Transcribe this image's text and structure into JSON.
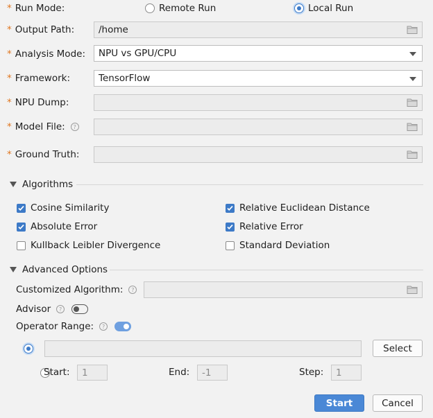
{
  "run_mode": {
    "label": "Run Mode:",
    "options": [
      "Remote Run",
      "Local Run"
    ],
    "selected": "Local Run"
  },
  "output_path": {
    "label": "Output Path:",
    "value": "/home"
  },
  "analysis_mode": {
    "label": "Analysis Mode:",
    "value": "NPU vs GPU/CPU"
  },
  "framework": {
    "label": "Framework:",
    "value": "TensorFlow"
  },
  "npu_dump": {
    "label": "NPU Dump:",
    "value": ""
  },
  "model_file": {
    "label": "Model File:",
    "value": ""
  },
  "ground_truth": {
    "label": "Ground Truth:",
    "value": ""
  },
  "algorithms": {
    "title": "Algorithms",
    "items": [
      {
        "label": "Cosine Similarity",
        "checked": true
      },
      {
        "label": "Relative Euclidean Distance",
        "checked": true
      },
      {
        "label": "Absolute Error",
        "checked": true
      },
      {
        "label": "Relative Error",
        "checked": true
      },
      {
        "label": "Kullback Leibler Divergence",
        "checked": false
      },
      {
        "label": "Standard Deviation",
        "checked": false
      }
    ]
  },
  "advanced": {
    "title": "Advanced Options",
    "customized_algorithm": {
      "label": "Customized Algorithm:",
      "value": ""
    },
    "advisor": {
      "label": "Advisor",
      "enabled": false
    },
    "operator_range": {
      "label": "Operator Range:",
      "enabled": true
    },
    "range_input": {
      "value": "",
      "select_label": "Select"
    },
    "start": {
      "label": "Start:",
      "value": "1"
    },
    "end": {
      "label": "End:",
      "value": "-1"
    },
    "step": {
      "label": "Step:",
      "value": "1"
    }
  },
  "footer": {
    "start_label": "Start",
    "cancel_label": "Cancel"
  },
  "colors": {
    "accent": "#4a88d6",
    "required": "#e0761f"
  },
  "icons": {
    "folder": "folder-icon",
    "help": "help-icon",
    "dropdown": "chevron-down-icon"
  }
}
